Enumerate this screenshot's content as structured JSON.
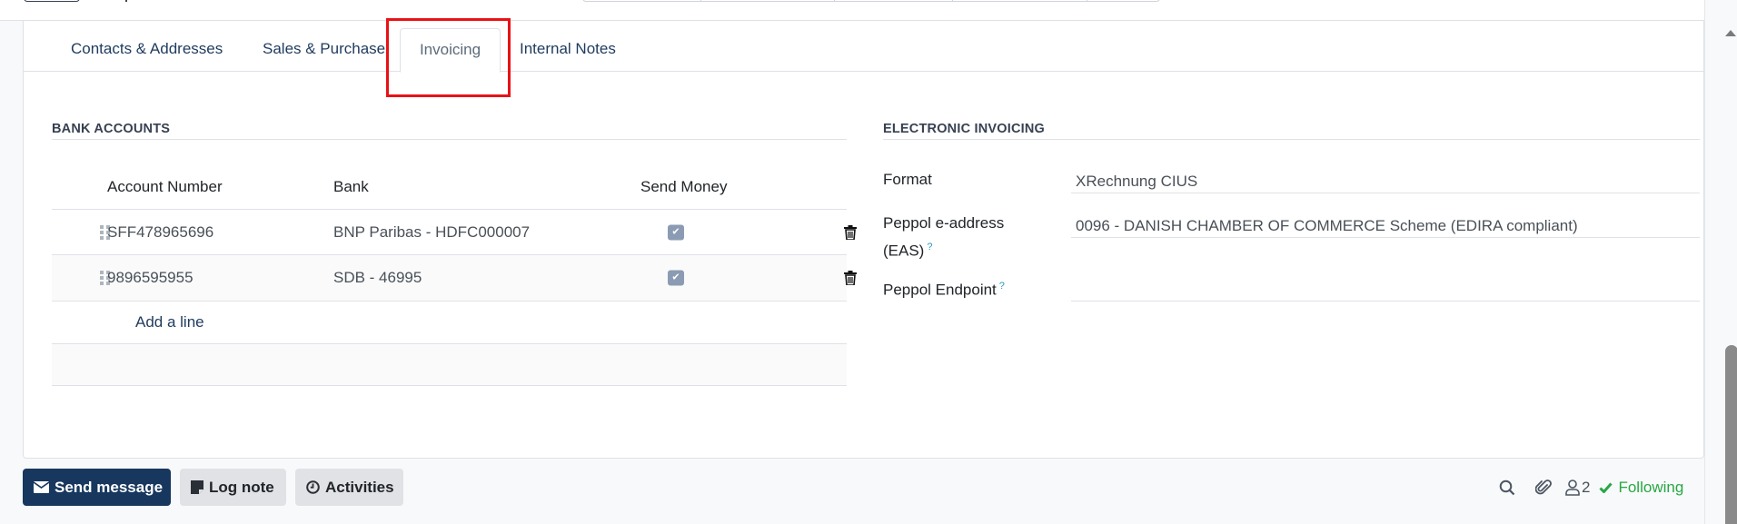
{
  "tabs": [
    {
      "label": "Contacts & Addresses",
      "active": false
    },
    {
      "label": "Sales & Purchase",
      "active": false
    },
    {
      "label": "Invoicing",
      "active": true
    },
    {
      "label": "Internal Notes",
      "active": false
    }
  ],
  "bank_accounts": {
    "title": "BANK ACCOUNTS",
    "columns": [
      "Account Number",
      "Bank",
      "Send Money"
    ],
    "rows": [
      {
        "account_number": "SFF478965696",
        "bank": "BNP Paribas - HDFC000007",
        "send_money": true
      },
      {
        "account_number": "9896595955",
        "bank": "SDB - 46995",
        "send_money": true
      }
    ],
    "add_line_label": "Add a line"
  },
  "electronic_invoicing": {
    "title": "ELECTRONIC INVOICING",
    "fields": [
      {
        "label": "Format",
        "value": "XRechnung CIUS",
        "help": false
      },
      {
        "label_line1": "Peppol e-address",
        "label_line2": "(EAS)",
        "value": "0096 - DANISH CHAMBER OF COMMERCE Scheme (EDIRA compliant)",
        "help": true
      },
      {
        "label": "Peppol Endpoint",
        "value": "",
        "help": true
      }
    ],
    "help_mark": "?"
  },
  "chatter": {
    "send_message": "Send message",
    "log_note": "Log note",
    "activities": "Activities",
    "followers_count": "2",
    "following": "Following"
  },
  "colors": {
    "primary": "#17375e",
    "highlight": "#e81216",
    "following": "#28a745",
    "checkbox": "#8b9bb3"
  }
}
